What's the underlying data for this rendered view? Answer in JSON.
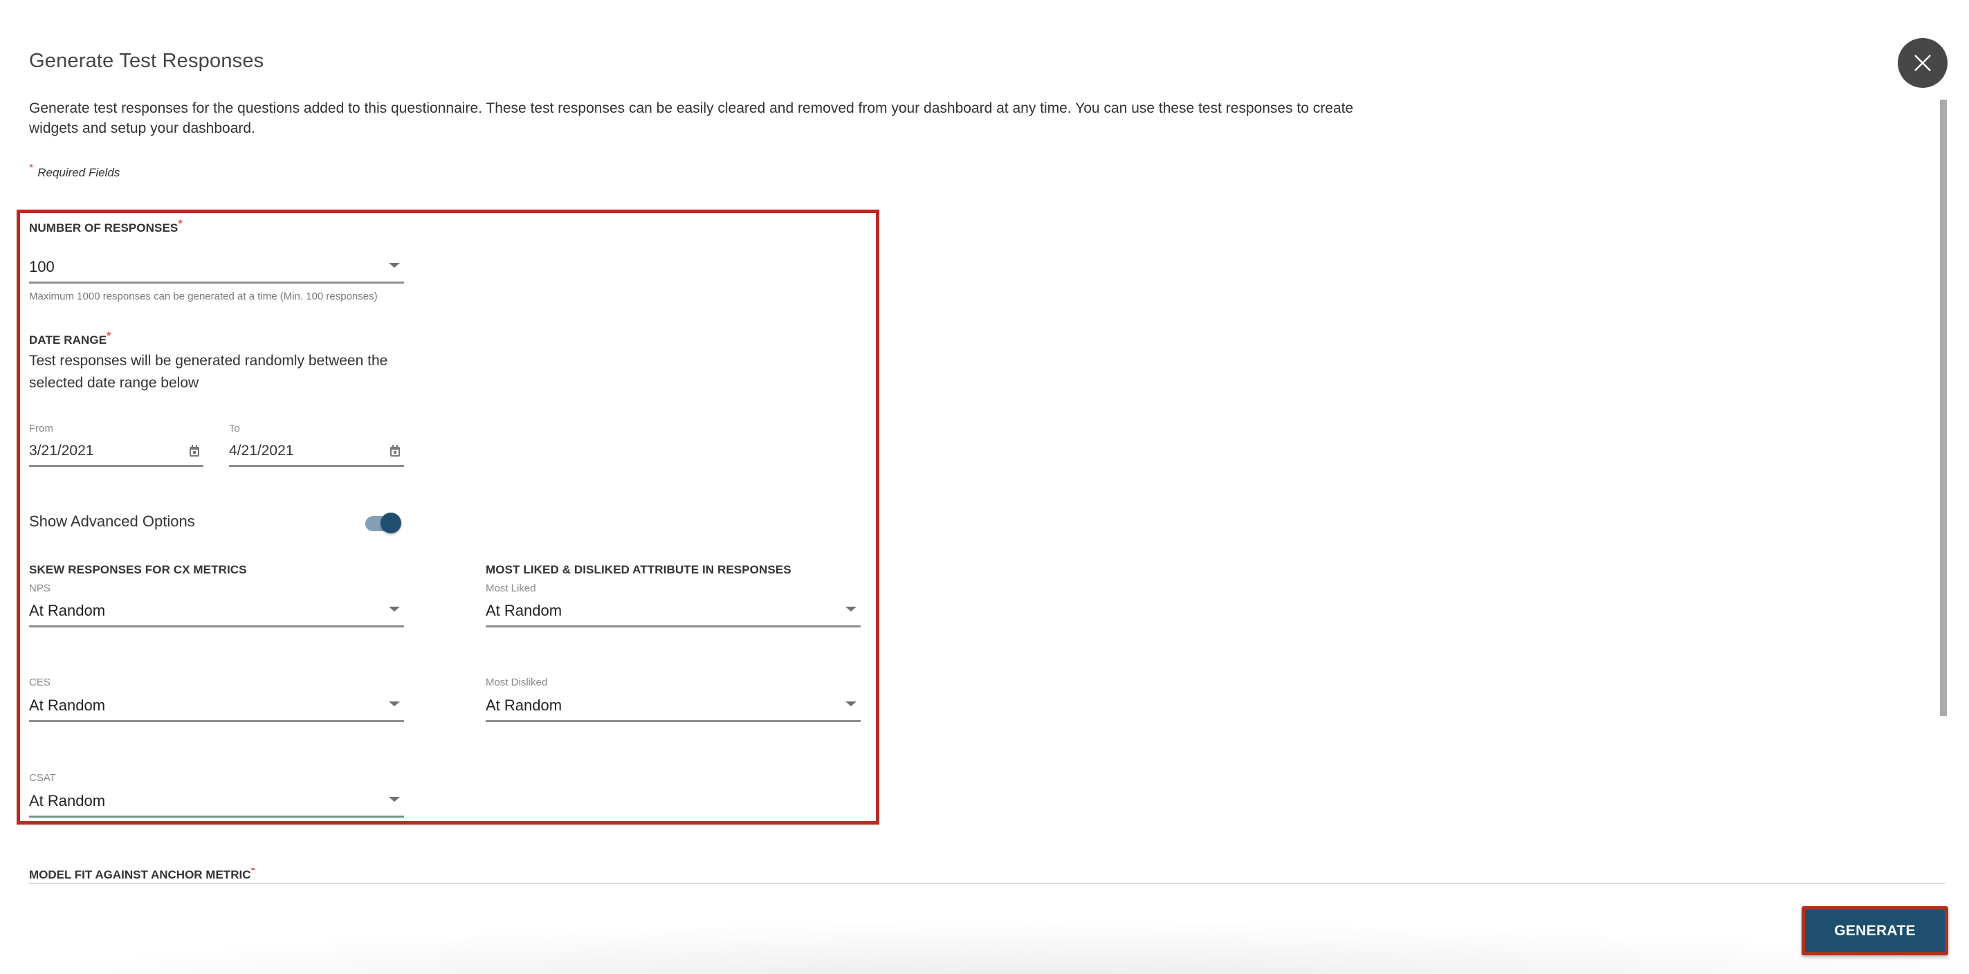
{
  "dialog": {
    "title": "Generate Test Responses",
    "description": "Generate test responses for the questions added to this questionnaire. These test responses can be easily cleared and removed from your dashboard at any time. You can use these test responses to create widgets and setup your dashboard.",
    "required_asterisk": "*",
    "required_note": "Required Fields",
    "close_icon": "close-icon"
  },
  "colors": {
    "highlight_border": "#b03020",
    "primary": "#1f4f6e",
    "toggle_track": "#839fb4",
    "required": "#e04b4b",
    "close_bg": "#474747"
  },
  "number_of_responses": {
    "label": "NUMBER OF RESPONSES",
    "value": "100",
    "hint": "Maximum 1000 responses can be generated at a time (Min. 100 responses)"
  },
  "date_range": {
    "label": "DATE RANGE",
    "description": "Test responses will be generated randomly between the selected date range below",
    "from_label": "From",
    "from_value": "3/21/2021",
    "to_label": "To",
    "to_value": "4/21/2021"
  },
  "advanced": {
    "label": "Show Advanced Options",
    "enabled": true
  },
  "skew": {
    "label": "SKEW RESPONSES FOR CX METRICS",
    "fields": [
      {
        "label": "NPS",
        "value": "At Random"
      },
      {
        "label": "CES",
        "value": "At Random"
      },
      {
        "label": "CSAT",
        "value": "At Random"
      }
    ]
  },
  "attributes": {
    "label": "MOST LIKED & DISLIKED ATTRIBUTE IN RESPONSES",
    "fields": [
      {
        "label": "Most Liked",
        "value": "At Random"
      },
      {
        "label": "Most Disliked",
        "value": "At Random"
      }
    ]
  },
  "model_fit": {
    "label": "MODEL FIT AGAINST ANCHOR METRIC"
  },
  "footer": {
    "generate_label": "GENERATE"
  }
}
